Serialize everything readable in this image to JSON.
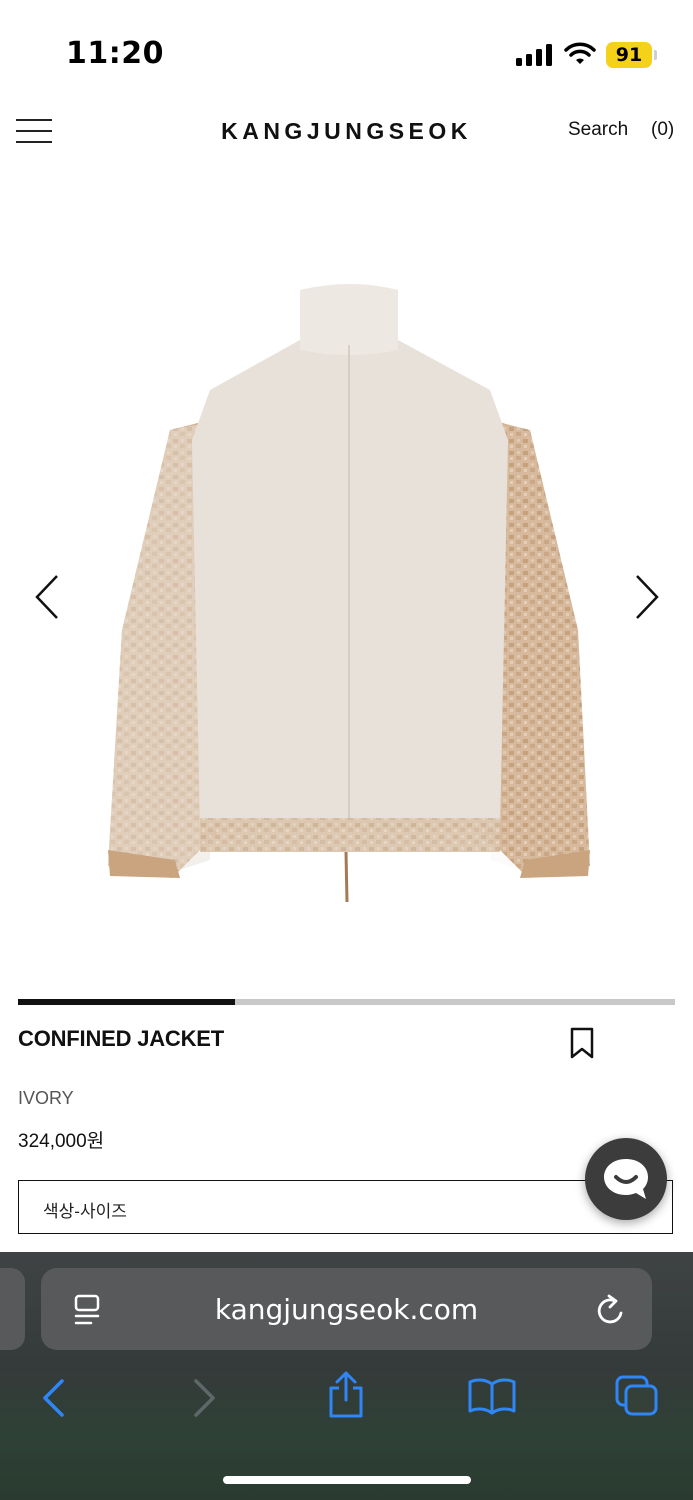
{
  "status_bar": {
    "time": "11:20",
    "battery": "91"
  },
  "header": {
    "brand": "KANGJUNGSEOK",
    "search_label": "Search",
    "cart_count": "(0)"
  },
  "product": {
    "name": "CONFINED JACKET",
    "color": "IVORY",
    "price": "324,000원",
    "option_placeholder": "색상-사이즈",
    "gallery_progress": 0.33
  },
  "browser": {
    "url": "kangjungseok.com"
  },
  "icons": {
    "menu": "hamburger-menu-icon",
    "prev": "chevron-left-icon",
    "next": "chevron-right-icon",
    "bookmark": "bookmark-icon",
    "chat": "chat-icon",
    "reader": "reader-mode-icon",
    "reload": "reload-icon",
    "back": "back-arrow-icon",
    "forward": "forward-arrow-icon",
    "share": "share-icon",
    "bookmarks": "open-book-icon",
    "tabs": "tabs-icon"
  },
  "colors": {
    "battery": "#f5d21a",
    "safari_accent": "#2f86f6",
    "jacket_body": "#e8e1da",
    "jacket_sleeve": "#cfae8c"
  }
}
